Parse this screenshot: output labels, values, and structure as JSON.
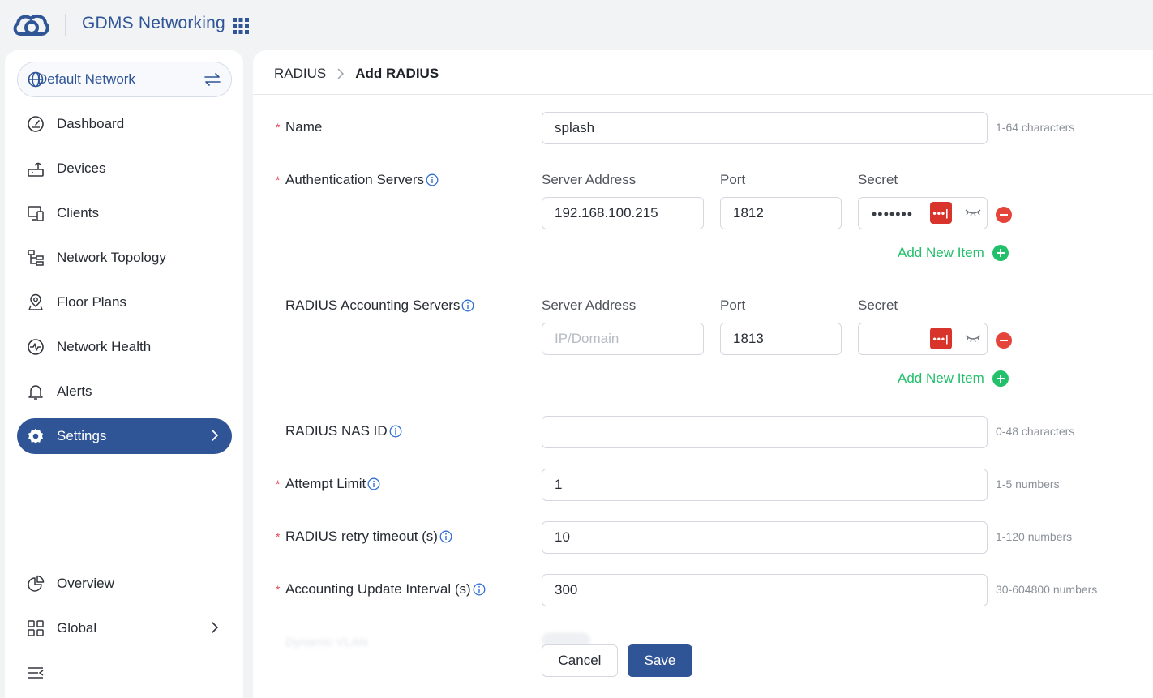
{
  "app": {
    "title": "GDMS Networking"
  },
  "network_selector": {
    "label": "Default Network"
  },
  "sidebar": {
    "items": [
      {
        "label": "Dashboard",
        "icon": "dashboard-gauge-icon"
      },
      {
        "label": "Devices",
        "icon": "router-icon"
      },
      {
        "label": "Clients",
        "icon": "monitor-phone-icon"
      },
      {
        "label": "Network Topology",
        "icon": "topology-icon"
      },
      {
        "label": "Floor Plans",
        "icon": "map-pin-icon"
      },
      {
        "label": "Network Health",
        "icon": "pulse-icon"
      },
      {
        "label": "Alerts",
        "icon": "bell-icon"
      },
      {
        "label": "Settings",
        "icon": "gear-icon",
        "active": true
      }
    ],
    "bottom": [
      {
        "label": "Overview",
        "icon": "pie-chart-icon"
      },
      {
        "label": "Global",
        "icon": "apps-grid-icon"
      }
    ]
  },
  "breadcrumb": {
    "parent": "RADIUS",
    "current": "Add RADIUS"
  },
  "form": {
    "name": {
      "label": "Name",
      "value": "splash",
      "hint": "1-64 characters"
    },
    "auth_servers": {
      "label": "Authentication Servers",
      "col_address": "Server Address",
      "col_port": "Port",
      "col_secret": "Secret",
      "address": "192.168.100.215",
      "port": "1812",
      "secret_mask": "•••••••",
      "add_label": "Add New Item"
    },
    "acct_servers": {
      "label": "RADIUS Accounting Servers",
      "col_address": "Server Address",
      "col_port": "Port",
      "col_secret": "Secret",
      "address_placeholder": "IP/Domain",
      "port": "1813",
      "add_label": "Add New Item"
    },
    "nas_id": {
      "label": "RADIUS NAS ID",
      "value": "",
      "hint": "0-48 characters"
    },
    "attempt_limit": {
      "label": "Attempt Limit",
      "value": "1",
      "hint": "1-5 numbers"
    },
    "retry_timeout": {
      "label": "RADIUS retry timeout (s)",
      "value": "10",
      "hint": "1-120 numbers"
    },
    "acct_interval": {
      "label": "Accounting Update Interval (s)",
      "value": "300",
      "hint": "30-604800 numbers"
    },
    "dynamic_vlan": {
      "label": "Dynamic VLAN"
    }
  },
  "actions": {
    "cancel": "Cancel",
    "save": "Save"
  },
  "colors": {
    "brand": "#2f5597",
    "success": "#22c06b",
    "danger": "#e5443a",
    "required": "#e5484d"
  }
}
